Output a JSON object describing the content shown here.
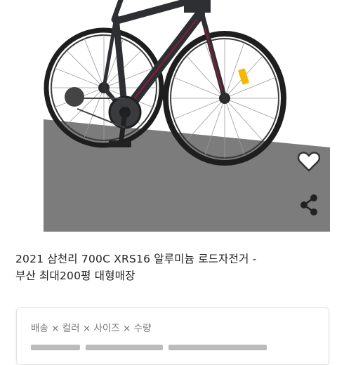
{
  "product": {
    "title_line1": "2021 삼천리 700C XRS16 알루미늄 로드자전거 -",
    "title_line2": "부산 최대200평 대형매장",
    "image_icon": "road-bike-photo"
  },
  "actions": {
    "like_icon": "heart-outline-icon",
    "share_icon": "share-icon"
  },
  "options": {
    "label": "배송 × 컬러 × 사이즈 × 수량"
  },
  "colors": {
    "frame": "#2d2f33",
    "accent": "#8b1a3a",
    "backdrop": "#7a7a7a",
    "reflector": "#f5b800"
  }
}
